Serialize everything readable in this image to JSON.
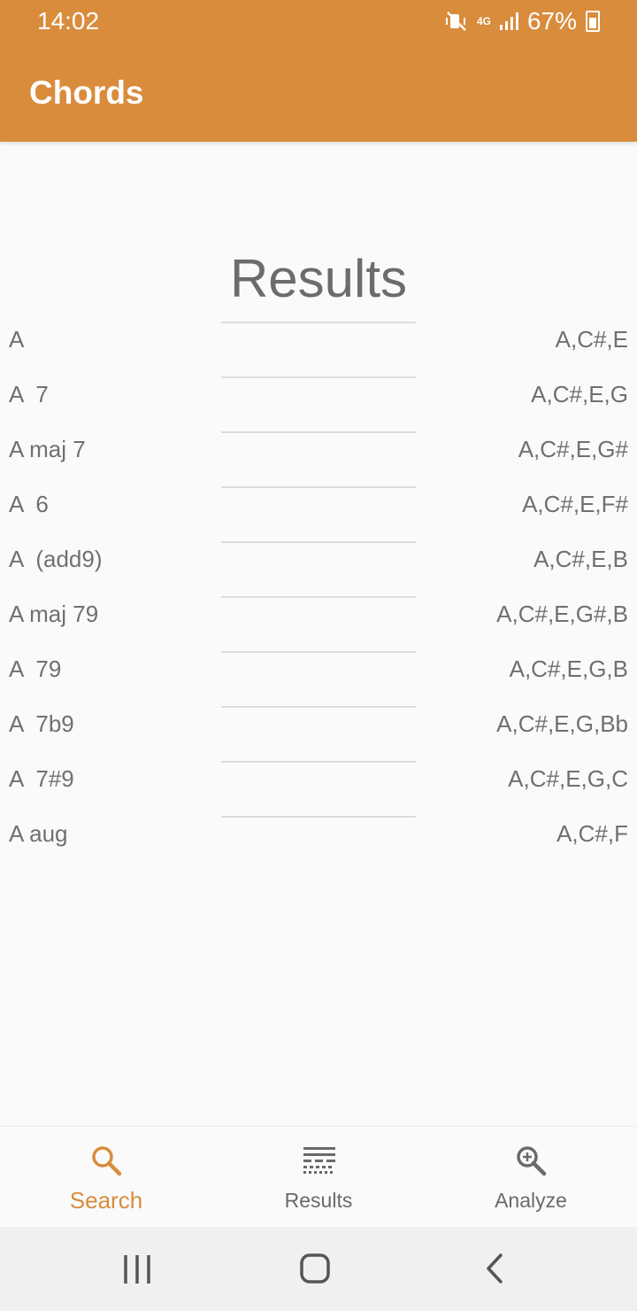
{
  "status_bar": {
    "time": "14:02",
    "network": "4G",
    "battery": "67%"
  },
  "app_bar": {
    "title": "Chords"
  },
  "main": {
    "heading": "Results",
    "chords": [
      {
        "name": "A",
        "notes": "A,C#,E"
      },
      {
        "name": "A  7",
        "notes": "A,C#,E,G"
      },
      {
        "name": "A maj 7",
        "notes": "A,C#,E,G#"
      },
      {
        "name": "A  6",
        "notes": "A,C#,E,F#"
      },
      {
        "name": "A  (add9)",
        "notes": "A,C#,E,B"
      },
      {
        "name": "A maj 79",
        "notes": "A,C#,E,G#,B"
      },
      {
        "name": "A  79",
        "notes": "A,C#,E,G,B"
      },
      {
        "name": "A  7b9",
        "notes": "A,C#,E,G,Bb"
      },
      {
        "name": "A  7#9",
        "notes": "A,C#,E,G,C"
      },
      {
        "name": "A aug",
        "notes": "A,C#,F"
      }
    ]
  },
  "bottom_nav": {
    "items": [
      {
        "label": "Search",
        "icon": "search-icon",
        "active": true
      },
      {
        "label": "Results",
        "icon": "results-icon",
        "active": false
      },
      {
        "label": "Analyze",
        "icon": "zoom-in-icon",
        "active": false
      }
    ]
  },
  "colors": {
    "accent": "#d98c3c",
    "text": "#707070",
    "background": "#fafafa"
  }
}
